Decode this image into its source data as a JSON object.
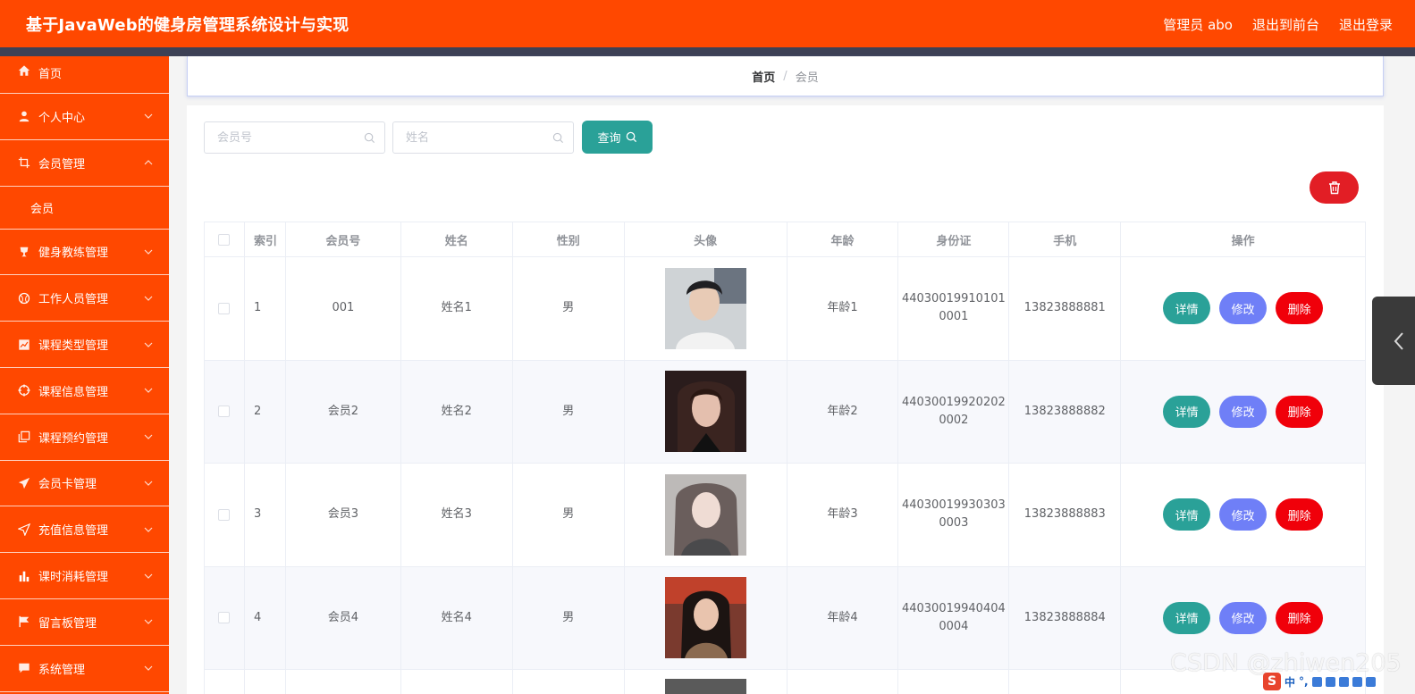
{
  "header": {
    "title": "基于JavaWeb的健身房管理系统设计与实现",
    "admin_label": "管理员 abo",
    "front_label": "退出到前台",
    "logout_label": "退出登录"
  },
  "sidebar": {
    "items": [
      {
        "label": "首页",
        "icon": "home-icon"
      },
      {
        "label": "个人中心",
        "icon": "user-icon"
      },
      {
        "label": "会员管理",
        "icon": "crop-icon",
        "expanded": true
      },
      {
        "label": "健身教练管理",
        "icon": "cup-icon"
      },
      {
        "label": "工作人员管理",
        "icon": "basketball-icon"
      },
      {
        "label": "课程类型管理",
        "icon": "chart-icon"
      },
      {
        "label": "课程信息管理",
        "icon": "aim-icon"
      },
      {
        "label": "课程预约管理",
        "icon": "copy-icon"
      },
      {
        "label": "会员卡管理",
        "icon": "send-icon"
      },
      {
        "label": "充值信息管理",
        "icon": "position-icon"
      },
      {
        "label": "课时消耗管理",
        "icon": "bar-icon"
      },
      {
        "label": "留言板管理",
        "icon": "flag-icon"
      },
      {
        "label": "系统管理",
        "icon": "chat-icon"
      }
    ],
    "sub_item": "会员"
  },
  "breadcrumb": {
    "home": "首页",
    "separator": "/",
    "current": "会员"
  },
  "search": {
    "member_no_placeholder": "会员号",
    "name_placeholder": "姓名",
    "query_label": "查询"
  },
  "table": {
    "headers": [
      "索引",
      "会员号",
      "姓名",
      "性别",
      "头像",
      "年龄",
      "身份证",
      "手机",
      "操作"
    ],
    "rows": [
      {
        "index": "1",
        "member_no": "001",
        "name": "姓名1",
        "gender": "男",
        "age": "年龄1",
        "id_line1": "44030019910101",
        "id_line2": "0001",
        "phone": "13823888881"
      },
      {
        "index": "2",
        "member_no": "会员2",
        "name": "姓名2",
        "gender": "男",
        "age": "年龄2",
        "id_line1": "44030019920202",
        "id_line2": "0002",
        "phone": "13823888882"
      },
      {
        "index": "3",
        "member_no": "会员3",
        "name": "姓名3",
        "gender": "男",
        "age": "年龄3",
        "id_line1": "44030019930303",
        "id_line2": "0003",
        "phone": "13823888883"
      },
      {
        "index": "4",
        "member_no": "会员4",
        "name": "姓名4",
        "gender": "男",
        "age": "年龄4",
        "id_line1": "44030019940404",
        "id_line2": "0004",
        "phone": "13823888884"
      }
    ],
    "actions": {
      "detail": "详情",
      "edit": "修改",
      "delete": "删除"
    }
  },
  "watermark": "CSDN @zhiwen205",
  "ime": {
    "lang": "中",
    "punct": "°,"
  },
  "colors": {
    "brand": "#ff4800",
    "header_bar": "#3d4155",
    "teal": "#2aa198",
    "edit": "#6f7ff7",
    "delete": "#f0000a"
  }
}
